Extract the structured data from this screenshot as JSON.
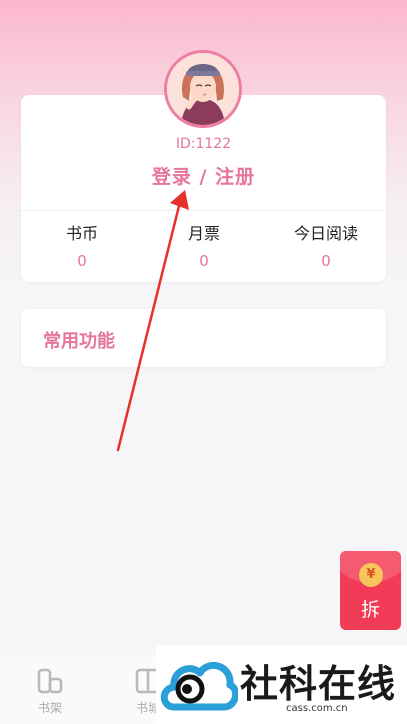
{
  "profile": {
    "id_text": "ID:1122",
    "login_text": "登录 / 注册",
    "stats": [
      {
        "label": "书币",
        "value": "0"
      },
      {
        "label": "月票",
        "value": "0"
      },
      {
        "label": "今日阅读",
        "value": "0"
      }
    ]
  },
  "functions": {
    "title": "常用功能"
  },
  "red_packet": {
    "coin_symbol": "¥",
    "label": "拆"
  },
  "tabbar": {
    "tabs": [
      {
        "label": "书架",
        "icon": "bookshelf-icon"
      },
      {
        "label": "书城",
        "icon": "bookstore-icon"
      }
    ]
  },
  "watermark": {
    "title": "社科在线",
    "subtitle": "cass.com.cn"
  },
  "colors": {
    "accent": "#e5759a",
    "red_packet": "#f23b57",
    "arrow": "#e8302a"
  }
}
